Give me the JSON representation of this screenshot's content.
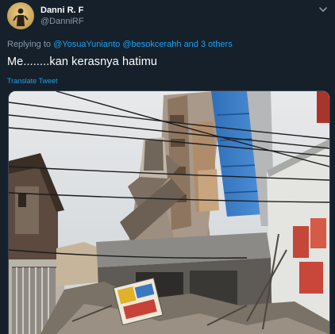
{
  "author": {
    "display_name": "Danni R. F",
    "handle": "@DanniRF"
  },
  "reply": {
    "prefix": "Replying to",
    "mentions": [
      "@YosuaYunianto",
      "@besokcerahh"
    ],
    "and_others": "and 3 others"
  },
  "tweet": {
    "text": "Me........kan kerasnya hatimu",
    "translate_label": "Translate Tweet"
  },
  "icons": {
    "more": "chevron-down-icon",
    "avatar": "avatar-image"
  },
  "colors": {
    "background": "#15202b",
    "link": "#1da1f2",
    "secondary_text": "#8899a6",
    "primary_text": "#ffffff"
  }
}
